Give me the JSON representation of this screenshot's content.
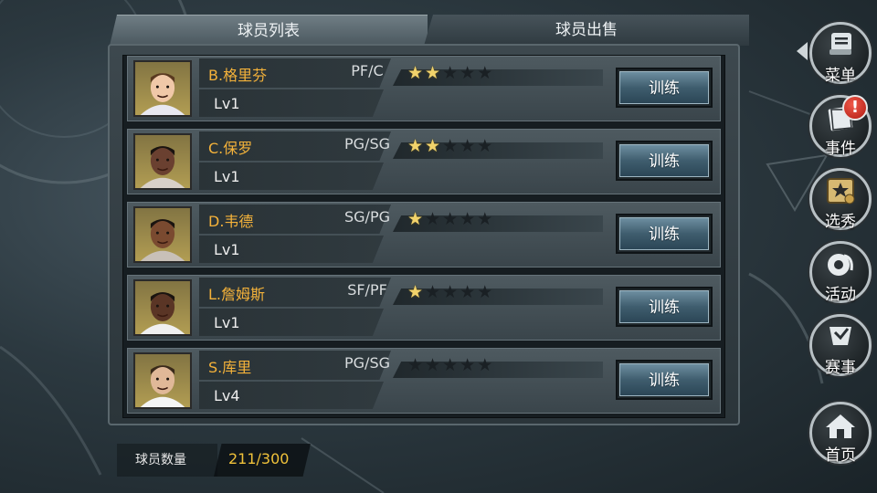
{
  "tabs": [
    {
      "label": "球员列表",
      "active": true
    },
    {
      "label": "球员出售",
      "active": false
    }
  ],
  "players": [
    {
      "name": "B.格里芬",
      "position": "PF/C",
      "level": "Lv1",
      "stars": 2,
      "max_stars": 5,
      "train_label": "训练"
    },
    {
      "name": "C.保罗",
      "position": "PG/SG",
      "level": "Lv1",
      "stars": 2,
      "max_stars": 5,
      "train_label": "训练"
    },
    {
      "name": "D.韦德",
      "position": "SG/PG",
      "level": "Lv1",
      "stars": 1,
      "max_stars": 5,
      "train_label": "训练"
    },
    {
      "name": "L.詹姆斯",
      "position": "SF/PF",
      "level": "Lv1",
      "stars": 1,
      "max_stars": 5,
      "train_label": "训练"
    },
    {
      "name": "S.库里",
      "position": "PG/SG",
      "level": "Lv4",
      "stars": 0,
      "max_stars": 5,
      "train_label": "训练"
    }
  ],
  "footer": {
    "count_label": "球员数量",
    "count_value": "211/300"
  },
  "side_menu": [
    {
      "label": "菜单",
      "icon": "menu-icon"
    },
    {
      "label": "事件",
      "icon": "event-icon",
      "alert": "!"
    },
    {
      "label": "选秀",
      "icon": "draft-icon"
    },
    {
      "label": "活动",
      "icon": "activity-icon"
    },
    {
      "label": "赛事",
      "icon": "tournament-icon"
    },
    {
      "label": "首页",
      "icon": "home-icon"
    }
  ],
  "colors": {
    "player_name": "#f4b23a",
    "count_value": "#f0c23a",
    "star_on": "#f2d36b",
    "star_off": "#1a2024",
    "train_button": "#4f6f80"
  }
}
